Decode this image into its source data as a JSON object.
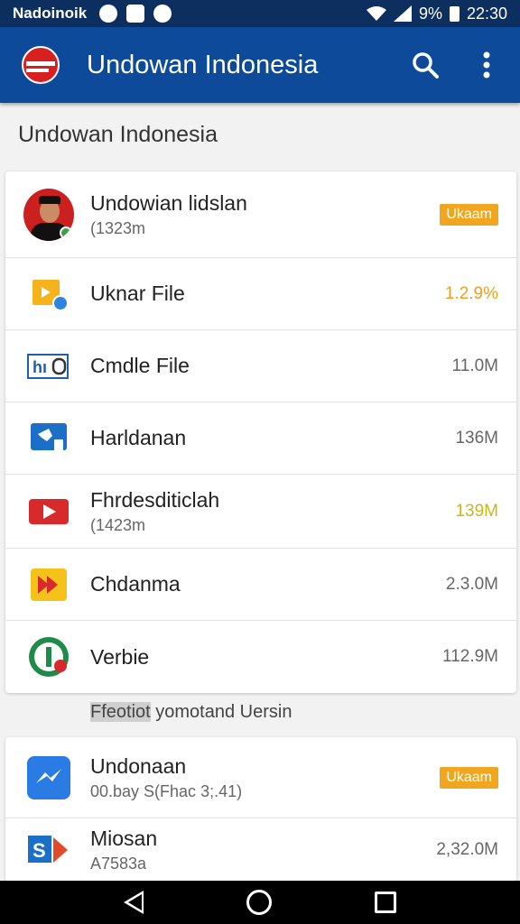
{
  "status_bar": {
    "carrier": "Nadoinoik",
    "battery_percent": "9%",
    "time": "22:30"
  },
  "app_bar": {
    "title": "Undowan Indonesia",
    "icons": [
      "flag-icon",
      "search-icon",
      "more-vert-icon"
    ]
  },
  "section_title": "Undowan  Indonesia",
  "list1": [
    {
      "name": "Undowian lidslan",
      "sub": "(1323m",
      "badge": "Ukaam",
      "icon": "avatar"
    },
    {
      "name": "Uknar File",
      "value": "1.2.9%",
      "value_color": "#e8a020",
      "icon": "folder-icon"
    },
    {
      "name": "Cmdle File",
      "value": "11.0M",
      "icon": "code-file-icon"
    },
    {
      "name": "Harldanan",
      "value": "136M",
      "icon": "tool-icon"
    },
    {
      "name": "Fhrdesditiclah",
      "sub": "(1423m",
      "value": "139M",
      "value_color": "#c8b818",
      "icon": "video-icon"
    },
    {
      "name": "Chdanma",
      "value": "2.3.0M",
      "icon": "play-icon"
    },
    {
      "name": "Verbie",
      "value": "112.9M",
      "icon": "badge-icon"
    }
  ],
  "footer": {
    "highlight": "Ffeotiot",
    "rest": " yomotand Uersin"
  },
  "list2": [
    {
      "name": "Undonaan",
      "sub": "00.bay S(Fhac 3;.41)",
      "badge": "Ukaam",
      "icon": "messenger-icon"
    },
    {
      "name": "Miosan",
      "sub": "A7583a",
      "value": "2,32.0M",
      "icon": "s-logo-icon"
    }
  ],
  "nav": {
    "icons": [
      "back-icon",
      "home-icon",
      "recents-icon"
    ]
  }
}
